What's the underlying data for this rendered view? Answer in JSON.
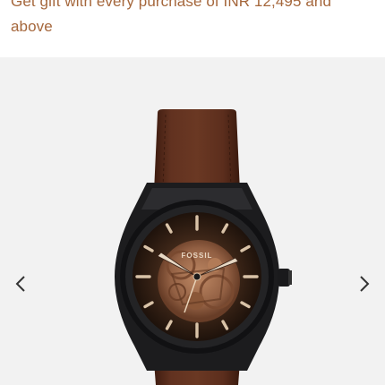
{
  "promo": {
    "text": "Get gift with every purchase of INR 12,495 and above",
    "color": "#a5673c"
  },
  "gallery": {
    "image": "skeleton-automatic-watch-brown-leather-strap",
    "prev_icon": "chevron-left-icon",
    "next_icon": "chevron-right-icon"
  },
  "watch": {
    "brand": "FOSSIL",
    "strap_color": "#5a2c1a",
    "case_color": "#1c1c1e",
    "dial_color": "#3a2418"
  }
}
